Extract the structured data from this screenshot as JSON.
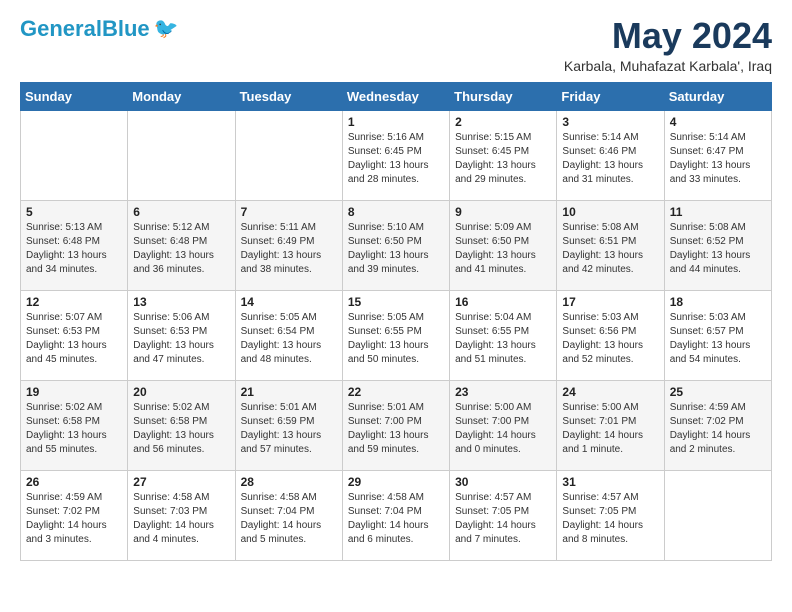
{
  "logo": {
    "part1": "General",
    "part2": "Blue"
  },
  "title": "May 2024",
  "location": "Karbala, Muhafazat Karbala', Iraq",
  "weekdays": [
    "Sunday",
    "Monday",
    "Tuesday",
    "Wednesday",
    "Thursday",
    "Friday",
    "Saturday"
  ],
  "weeks": [
    [
      {
        "day": "",
        "text": ""
      },
      {
        "day": "",
        "text": ""
      },
      {
        "day": "",
        "text": ""
      },
      {
        "day": "1",
        "text": "Sunrise: 5:16 AM\nSunset: 6:45 PM\nDaylight: 13 hours\nand 28 minutes."
      },
      {
        "day": "2",
        "text": "Sunrise: 5:15 AM\nSunset: 6:45 PM\nDaylight: 13 hours\nand 29 minutes."
      },
      {
        "day": "3",
        "text": "Sunrise: 5:14 AM\nSunset: 6:46 PM\nDaylight: 13 hours\nand 31 minutes."
      },
      {
        "day": "4",
        "text": "Sunrise: 5:14 AM\nSunset: 6:47 PM\nDaylight: 13 hours\nand 33 minutes."
      }
    ],
    [
      {
        "day": "5",
        "text": "Sunrise: 5:13 AM\nSunset: 6:48 PM\nDaylight: 13 hours\nand 34 minutes."
      },
      {
        "day": "6",
        "text": "Sunrise: 5:12 AM\nSunset: 6:48 PM\nDaylight: 13 hours\nand 36 minutes."
      },
      {
        "day": "7",
        "text": "Sunrise: 5:11 AM\nSunset: 6:49 PM\nDaylight: 13 hours\nand 38 minutes."
      },
      {
        "day": "8",
        "text": "Sunrise: 5:10 AM\nSunset: 6:50 PM\nDaylight: 13 hours\nand 39 minutes."
      },
      {
        "day": "9",
        "text": "Sunrise: 5:09 AM\nSunset: 6:50 PM\nDaylight: 13 hours\nand 41 minutes."
      },
      {
        "day": "10",
        "text": "Sunrise: 5:08 AM\nSunset: 6:51 PM\nDaylight: 13 hours\nand 42 minutes."
      },
      {
        "day": "11",
        "text": "Sunrise: 5:08 AM\nSunset: 6:52 PM\nDaylight: 13 hours\nand 44 minutes."
      }
    ],
    [
      {
        "day": "12",
        "text": "Sunrise: 5:07 AM\nSunset: 6:53 PM\nDaylight: 13 hours\nand 45 minutes."
      },
      {
        "day": "13",
        "text": "Sunrise: 5:06 AM\nSunset: 6:53 PM\nDaylight: 13 hours\nand 47 minutes."
      },
      {
        "day": "14",
        "text": "Sunrise: 5:05 AM\nSunset: 6:54 PM\nDaylight: 13 hours\nand 48 minutes."
      },
      {
        "day": "15",
        "text": "Sunrise: 5:05 AM\nSunset: 6:55 PM\nDaylight: 13 hours\nand 50 minutes."
      },
      {
        "day": "16",
        "text": "Sunrise: 5:04 AM\nSunset: 6:55 PM\nDaylight: 13 hours\nand 51 minutes."
      },
      {
        "day": "17",
        "text": "Sunrise: 5:03 AM\nSunset: 6:56 PM\nDaylight: 13 hours\nand 52 minutes."
      },
      {
        "day": "18",
        "text": "Sunrise: 5:03 AM\nSunset: 6:57 PM\nDaylight: 13 hours\nand 54 minutes."
      }
    ],
    [
      {
        "day": "19",
        "text": "Sunrise: 5:02 AM\nSunset: 6:58 PM\nDaylight: 13 hours\nand 55 minutes."
      },
      {
        "day": "20",
        "text": "Sunrise: 5:02 AM\nSunset: 6:58 PM\nDaylight: 13 hours\nand 56 minutes."
      },
      {
        "day": "21",
        "text": "Sunrise: 5:01 AM\nSunset: 6:59 PM\nDaylight: 13 hours\nand 57 minutes."
      },
      {
        "day": "22",
        "text": "Sunrise: 5:01 AM\nSunset: 7:00 PM\nDaylight: 13 hours\nand 59 minutes."
      },
      {
        "day": "23",
        "text": "Sunrise: 5:00 AM\nSunset: 7:00 PM\nDaylight: 14 hours\nand 0 minutes."
      },
      {
        "day": "24",
        "text": "Sunrise: 5:00 AM\nSunset: 7:01 PM\nDaylight: 14 hours\nand 1 minute."
      },
      {
        "day": "25",
        "text": "Sunrise: 4:59 AM\nSunset: 7:02 PM\nDaylight: 14 hours\nand 2 minutes."
      }
    ],
    [
      {
        "day": "26",
        "text": "Sunrise: 4:59 AM\nSunset: 7:02 PM\nDaylight: 14 hours\nand 3 minutes."
      },
      {
        "day": "27",
        "text": "Sunrise: 4:58 AM\nSunset: 7:03 PM\nDaylight: 14 hours\nand 4 minutes."
      },
      {
        "day": "28",
        "text": "Sunrise: 4:58 AM\nSunset: 7:04 PM\nDaylight: 14 hours\nand 5 minutes."
      },
      {
        "day": "29",
        "text": "Sunrise: 4:58 AM\nSunset: 7:04 PM\nDaylight: 14 hours\nand 6 minutes."
      },
      {
        "day": "30",
        "text": "Sunrise: 4:57 AM\nSunset: 7:05 PM\nDaylight: 14 hours\nand 7 minutes."
      },
      {
        "day": "31",
        "text": "Sunrise: 4:57 AM\nSunset: 7:05 PM\nDaylight: 14 hours\nand 8 minutes."
      },
      {
        "day": "",
        "text": ""
      }
    ]
  ]
}
